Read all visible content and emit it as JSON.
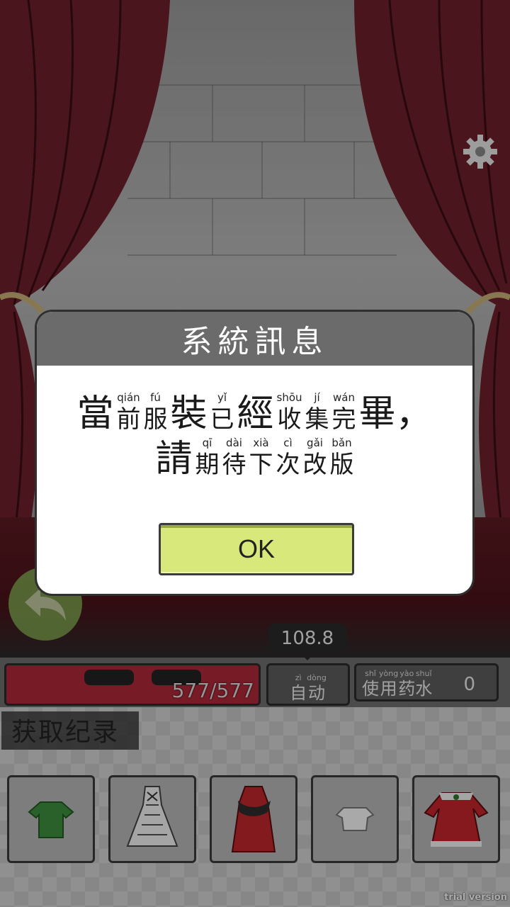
{
  "dialog": {
    "title": "系統訊息",
    "line1": [
      {
        "hz": "當",
        "py": ""
      },
      {
        "hz": "前",
        "py": "qián"
      },
      {
        "hz": "服",
        "py": "fú"
      },
      {
        "hz": "裝",
        "py": ""
      },
      {
        "hz": "已",
        "py": "yǐ"
      },
      {
        "hz": "經",
        "py": ""
      },
      {
        "hz": "收",
        "py": "shōu"
      },
      {
        "hz": "集",
        "py": "jí"
      },
      {
        "hz": "完",
        "py": "wán"
      },
      {
        "hz": "畢，",
        "py": ""
      }
    ],
    "line2": [
      {
        "hz": "請",
        "py": ""
      },
      {
        "hz": "期",
        "py": "qī"
      },
      {
        "hz": "待",
        "py": "dài"
      },
      {
        "hz": "下",
        "py": "xià"
      },
      {
        "hz": "次",
        "py": "cì"
      },
      {
        "hz": "改",
        "py": "gǎi"
      },
      {
        "hz": "版",
        "py": "bǎn"
      }
    ],
    "ok_label": "OK"
  },
  "hud": {
    "tooltip_value": "108.8",
    "hp_text": "577/577",
    "auto": [
      {
        "hz": "自",
        "py": "zì"
      },
      {
        "hz": "动",
        "py": "dòng"
      }
    ],
    "potion": [
      {
        "hz": "使",
        "py": "shǐ"
      },
      {
        "hz": "用",
        "py": "yòng"
      },
      {
        "hz": "药",
        "py": "yào"
      },
      {
        "hz": "水",
        "py": "shuǐ"
      }
    ],
    "potion_count": "0"
  },
  "record": {
    "title": "获取纪录",
    "items": [
      {
        "icon": "green-shirt-icon"
      },
      {
        "icon": "white-dress-icon"
      },
      {
        "icon": "red-cloak-icon"
      },
      {
        "icon": "white-top-icon"
      },
      {
        "icon": "santa-dress-icon"
      }
    ]
  },
  "watermark": "trial version",
  "colors": {
    "ok_button": "#d9e87a",
    "dialog_header": "#6b6b6b",
    "curtain": "#6e1f2a",
    "back_button": "#7fa34f"
  }
}
